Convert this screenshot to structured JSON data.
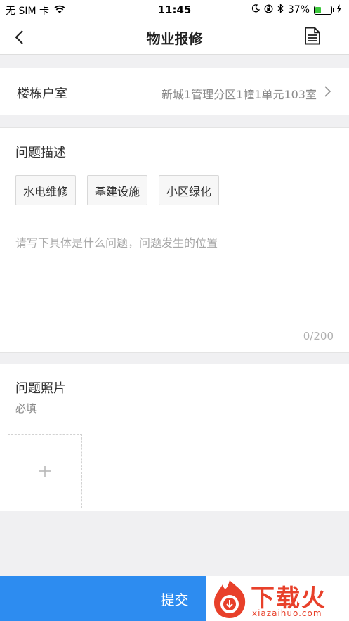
{
  "status_bar": {
    "carrier": "无 SIM 卡",
    "time": "11:45",
    "battery_percent": "37%",
    "battery_level": 0.37,
    "icons": [
      "wifi-icon",
      "moon-icon",
      "orientation-lock-icon",
      "bluetooth-icon",
      "battery-icon",
      "charging-icon"
    ]
  },
  "nav": {
    "title": "物业报修",
    "back_icon": "chevron-left-icon",
    "right_icon": "document-icon"
  },
  "room": {
    "label": "楼栋户室",
    "value": "新城1管理分区1幢1单元103室"
  },
  "description": {
    "title": "问题描述",
    "tags": [
      "水电维修",
      "基建设施",
      "小区绿化"
    ],
    "placeholder": "请写下具体是什么问题，问题发生的位置",
    "value": "",
    "counter": "0/200"
  },
  "photos": {
    "title": "问题照片",
    "note": "必填",
    "add_icon": "plus-icon"
  },
  "actions": {
    "submit_label": "提交"
  },
  "watermark": {
    "brand": "下载火",
    "domain": "xiazaihuo.com"
  },
  "colors": {
    "accent": "#2d8cf0",
    "watermark": "#e8402a",
    "battery": "#3cc83c"
  }
}
